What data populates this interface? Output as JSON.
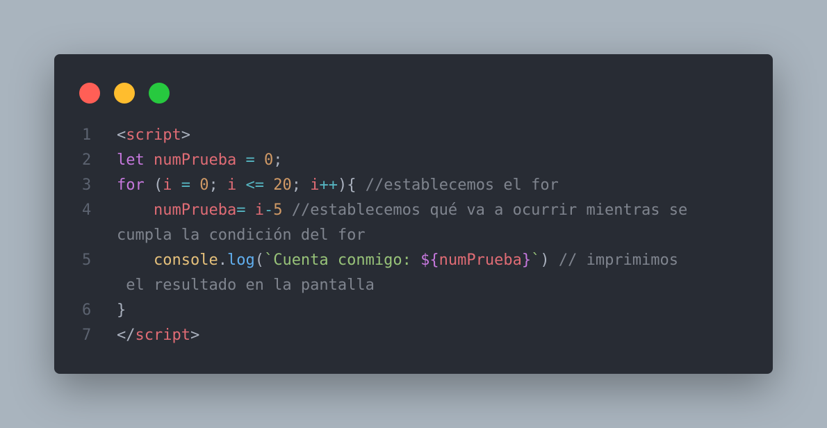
{
  "window": {
    "buttons": [
      {
        "name": "close",
        "color": "#ff5f56"
      },
      {
        "name": "minimize",
        "color": "#ffbd2e"
      },
      {
        "name": "maximize",
        "color": "#27c93f"
      }
    ]
  },
  "code": {
    "lines": [
      {
        "num": "1",
        "tokens": [
          {
            "t": "<",
            "c": "punc"
          },
          {
            "t": "script",
            "c": "tag"
          },
          {
            "t": ">",
            "c": "punc"
          }
        ]
      },
      {
        "num": "2",
        "tokens": [
          {
            "t": "let",
            "c": "kw"
          },
          {
            "t": " ",
            "c": "punc"
          },
          {
            "t": "numPrueba",
            "c": "var"
          },
          {
            "t": " ",
            "c": "punc"
          },
          {
            "t": "=",
            "c": "op"
          },
          {
            "t": " ",
            "c": "punc"
          },
          {
            "t": "0",
            "c": "num"
          },
          {
            "t": ";",
            "c": "punc"
          }
        ]
      },
      {
        "num": "3",
        "tokens": [
          {
            "t": "for",
            "c": "kw"
          },
          {
            "t": " (",
            "c": "punc"
          },
          {
            "t": "i",
            "c": "var"
          },
          {
            "t": " ",
            "c": "punc"
          },
          {
            "t": "=",
            "c": "op"
          },
          {
            "t": " ",
            "c": "punc"
          },
          {
            "t": "0",
            "c": "num"
          },
          {
            "t": "; ",
            "c": "punc"
          },
          {
            "t": "i",
            "c": "var"
          },
          {
            "t": " ",
            "c": "punc"
          },
          {
            "t": "<=",
            "c": "op"
          },
          {
            "t": " ",
            "c": "punc"
          },
          {
            "t": "20",
            "c": "num"
          },
          {
            "t": "; ",
            "c": "punc"
          },
          {
            "t": "i",
            "c": "var"
          },
          {
            "t": "++",
            "c": "op"
          },
          {
            "t": "){ ",
            "c": "punc"
          },
          {
            "t": "//establecemos el for",
            "c": "cmt"
          }
        ]
      },
      {
        "num": "4",
        "tokens": [
          {
            "t": "    ",
            "c": "punc"
          },
          {
            "t": "numPrueba",
            "c": "var"
          },
          {
            "t": "=",
            "c": "op"
          },
          {
            "t": " ",
            "c": "punc"
          },
          {
            "t": "i",
            "c": "var"
          },
          {
            "t": "-",
            "c": "op"
          },
          {
            "t": "5",
            "c": "num"
          },
          {
            "t": " ",
            "c": "punc"
          },
          {
            "t": "//establecemos qué va a ocurrir mientras se",
            "c": "cmt"
          }
        ]
      },
      {
        "num": "",
        "tokens": [
          {
            "t": "cumpla la condición del for",
            "c": "cmt"
          }
        ]
      },
      {
        "num": "5",
        "tokens": [
          {
            "t": "    ",
            "c": "punc"
          },
          {
            "t": "console",
            "c": "obj"
          },
          {
            "t": ".",
            "c": "punc"
          },
          {
            "t": "log",
            "c": "fn"
          },
          {
            "t": "(",
            "c": "punc"
          },
          {
            "t": "`Cuenta conmigo: ",
            "c": "str"
          },
          {
            "t": "${",
            "c": "interp"
          },
          {
            "t": "numPrueba",
            "c": "var"
          },
          {
            "t": "}",
            "c": "interp"
          },
          {
            "t": "`",
            "c": "str"
          },
          {
            "t": ") ",
            "c": "punc"
          },
          {
            "t": "// imprimimos",
            "c": "cmt"
          }
        ]
      },
      {
        "num": "",
        "tokens": [
          {
            "t": " el resultado en la pantalla",
            "c": "cmt"
          }
        ]
      },
      {
        "num": "6",
        "tokens": [
          {
            "t": "}",
            "c": "punc"
          }
        ]
      },
      {
        "num": "7",
        "tokens": [
          {
            "t": "</",
            "c": "punc"
          },
          {
            "t": "script",
            "c": "tag"
          },
          {
            "t": ">",
            "c": "punc"
          }
        ]
      }
    ]
  }
}
